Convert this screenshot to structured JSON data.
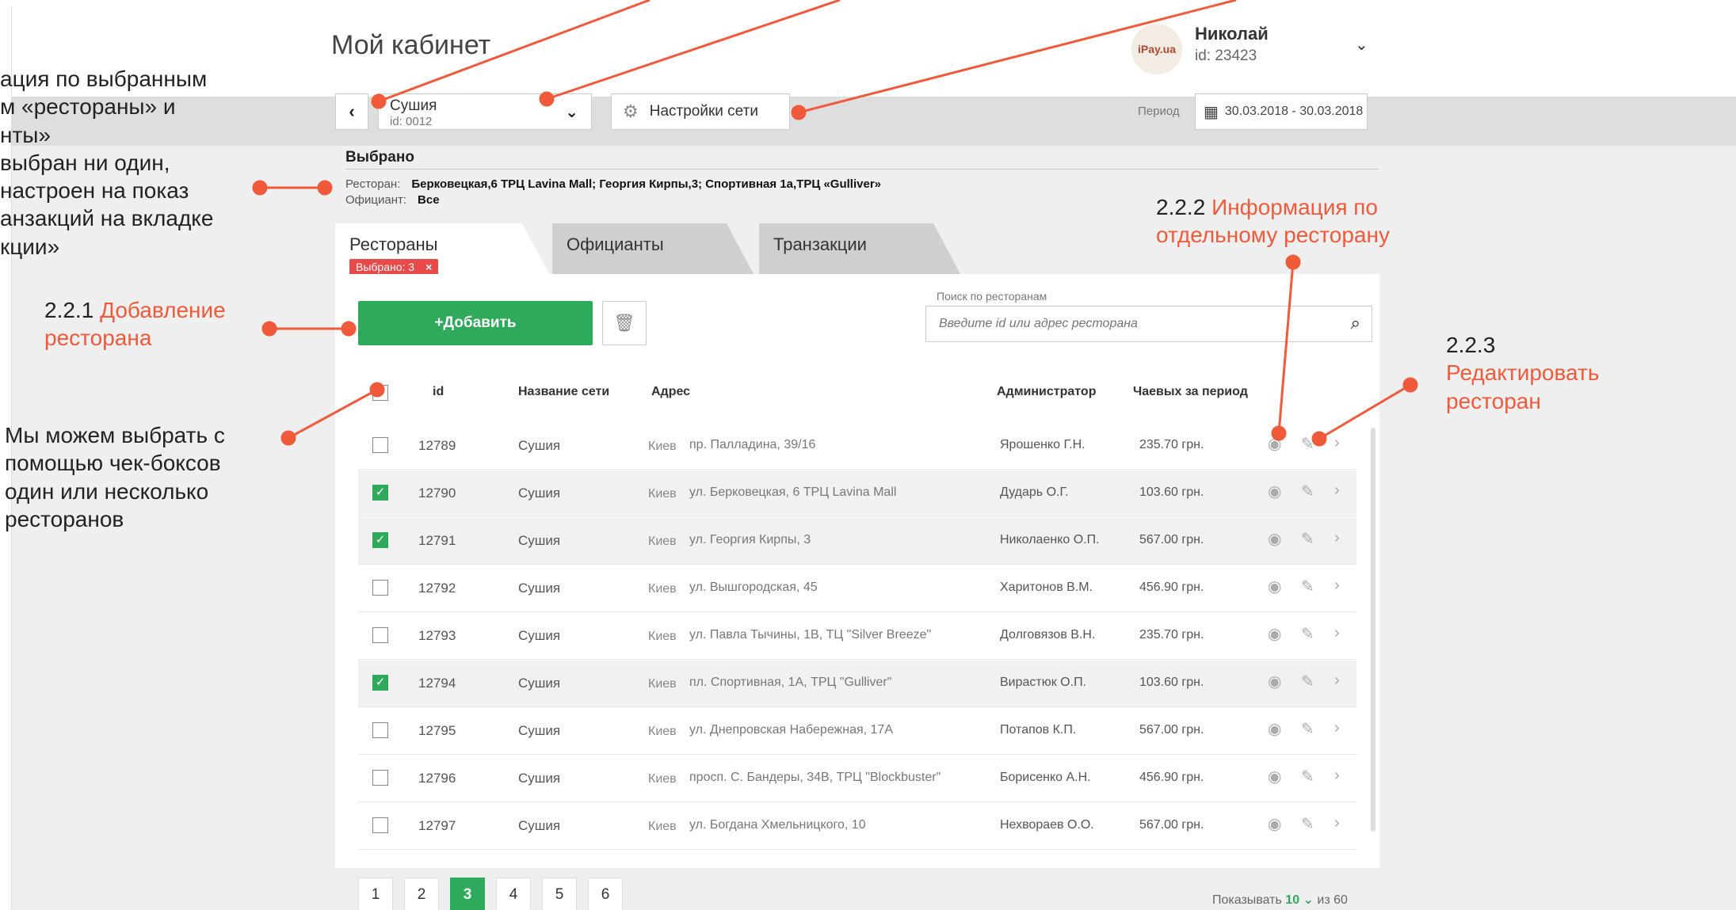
{
  "header": {
    "title": "Мой кабинет"
  },
  "user": {
    "avatar_text": "iPay.ua",
    "name": "Николай",
    "id": "id: 23423"
  },
  "network": {
    "name": "Сушия",
    "id": "id: 0012",
    "settings": "Настройки сети"
  },
  "period": {
    "label": "Период",
    "value": "30.03.2018 - 30.03.2018"
  },
  "selected": {
    "title": "Выбрано",
    "restaurants_label": "Ресторан:",
    "restaurants_value": "Берковецкая,6 ТРЦ Lavina Mall; Георгия Кирпы,3; Спортивная 1а,ТРЦ «Gulliver»",
    "waiter_label": "Официант:",
    "waiter_value": "Все"
  },
  "tabs": [
    {
      "label": "Рестораны",
      "badge": "Выбрано: 3"
    },
    {
      "label": "Официанты"
    },
    {
      "label": "Транзакции"
    }
  ],
  "toolbar": {
    "add_label": "+Добавить",
    "search_label": "Поиск по ресторанам",
    "search_placeholder": "Введите id или адрес ресторана"
  },
  "table": {
    "headers": {
      "id": "id",
      "network": "Название сети",
      "address": "Адрес",
      "admin": "Администратор",
      "tips": "Чаевых за период"
    },
    "rows": [
      {
        "id": "12789",
        "network": "Сушия",
        "city": "Киев",
        "address": "пр. Палладина, 39/16",
        "admin": "Ярошенко Г.Н.",
        "tips": "235.70 грн.",
        "checked": false
      },
      {
        "id": "12790",
        "network": "Сушия",
        "city": "Киев",
        "address": "ул. Берковецкая, 6 ТРЦ Lavina Mall",
        "admin": "Дударь О.Г.",
        "tips": "103.60 грн.",
        "checked": true
      },
      {
        "id": "12791",
        "network": "Сушия",
        "city": "Киев",
        "address": "ул. Георгия Кирпы, 3",
        "admin": "Николаенко О.П.",
        "tips": "567.00 грн.",
        "checked": true
      },
      {
        "id": "12792",
        "network": "Сушия",
        "city": "Киев",
        "address": "ул. Вышгородская, 45",
        "admin": "Харитонов В.М.",
        "tips": "456.90 грн.",
        "checked": false
      },
      {
        "id": "12793",
        "network": "Сушия",
        "city": "Киев",
        "address": "ул. Павла Тычины, 1В, ТЦ \"Silver Breeze\"",
        "admin": "Долговязов В.Н.",
        "tips": "235.70 грн.",
        "checked": false
      },
      {
        "id": "12794",
        "network": "Сушия",
        "city": "Киев",
        "address": "пл. Спортивная, 1А, ТРЦ \"Gulliver\"",
        "admin": "Вирастюк О.П.",
        "tips": "103.60 грн.",
        "checked": true
      },
      {
        "id": "12795",
        "network": "Сушия",
        "city": "Киев",
        "address": "ул. Днепровская Набережная, 17А",
        "admin": "Потапов К.П.",
        "tips": "567.00 грн.",
        "checked": false
      },
      {
        "id": "12796",
        "network": "Сушия",
        "city": "Киев",
        "address": "просп. С. Бандеры, 34В, ТРЦ \"Blockbuster\"",
        "admin": "Борисенко А.Н.",
        "tips": "456.90 грн.",
        "checked": false
      },
      {
        "id": "12797",
        "network": "Сушия",
        "city": "Киев",
        "address": "ул. Богдана Хмельницкого, 10",
        "admin": "Нехвораев О.О.",
        "tips": "567.00 грн.",
        "checked": false
      }
    ]
  },
  "pagination": {
    "pages": [
      "1",
      "2",
      "3",
      "4",
      "5",
      "6"
    ],
    "current": "3",
    "show_label": "Показывать",
    "per_page": "10",
    "of_label": "из 60"
  },
  "annotations": {
    "filter": [
      "ация по выбранным",
      "м «рестораны» и",
      "нты»",
      "выбран ни один,",
      "настроен на показ",
      "анзакций на вкладке",
      "кции»"
    ],
    "add_num": "2.2.1",
    "add_text": [
      "Добавление",
      "ресторана"
    ],
    "info_num": "2.2.2",
    "info_text": [
      "Информация по",
      "отдельному ресторану"
    ],
    "edit_num": "2.2.3",
    "edit_text": [
      "Редактировать",
      "ресторан"
    ],
    "checkbox_note": [
      "Мы можем выбрать с",
      "помощью чек-боксов",
      "один или несколько",
      "ресторанов"
    ]
  },
  "colors": {
    "accent": "#2faa5d",
    "annotation": "#f05a3a",
    "badge": "#e84a4a"
  }
}
